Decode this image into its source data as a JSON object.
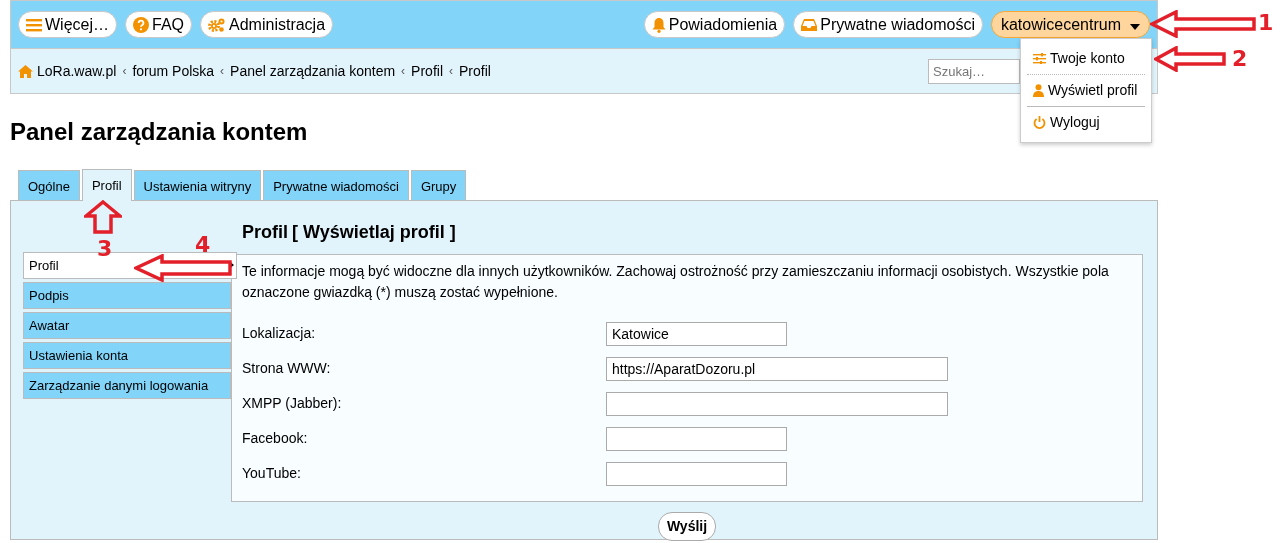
{
  "top_nav": {
    "left": [
      {
        "label": "Więcej…"
      },
      {
        "label": "FAQ"
      },
      {
        "label": "Administracja"
      }
    ],
    "right": [
      {
        "label": "Powiadomienia"
      },
      {
        "label": "Prywatne wiadomości"
      }
    ],
    "user": {
      "label": "katowicecentrum",
      "expanded": true
    }
  },
  "breadcrumbs": [
    {
      "label": "LoRa.waw.pl"
    },
    {
      "separator": "‹",
      "label": "forum Polska"
    },
    {
      "separator": "‹",
      "label": "Panel zarządzania kontem"
    },
    {
      "separator": "‹",
      "label": "Profil"
    },
    {
      "separator": "‹",
      "label": "Profil"
    }
  ],
  "search": {
    "placeholder": "Szukaj…"
  },
  "user_menu": [
    {
      "label": "Twoje konto"
    },
    {
      "label": "Wyświetl profil"
    },
    {
      "label": "Wyloguj"
    }
  ],
  "page_title": "Panel zarządzania kontem",
  "tabs": [
    {
      "label": "Ogólne",
      "selected": false
    },
    {
      "label": "Profil",
      "selected": true
    },
    {
      "label": "Ustawienia witryny",
      "selected": false
    },
    {
      "label": "Prywatne wiadomości",
      "selected": false
    },
    {
      "label": "Grupy",
      "selected": false
    }
  ],
  "sidebar": [
    {
      "label": "Profil",
      "selected": true
    },
    {
      "label": "Podpis",
      "selected": false
    },
    {
      "label": "Awatar",
      "selected": false
    },
    {
      "label": "Ustawienia konta",
      "selected": false
    },
    {
      "label": "Zarządzanie danymi logowania",
      "selected": false
    }
  ],
  "section": {
    "title": "Profil",
    "open_bracket": "[",
    "link": "Wyświetlaj profil",
    "close_bracket": "]"
  },
  "notice": "Te informacje mogą być widoczne dla innych użytkowników. Zachowaj ostrożność przy zamieszczaniu informacji osobistych. Wszystkie pola oznaczone gwiazdką (*) muszą zostać wypełnione.",
  "fields": [
    {
      "label": "Lokalizacja:",
      "value": "Katowice",
      "kind": "short"
    },
    {
      "label": "Strona WWW:",
      "value": "https://AparatDozoru.pl",
      "kind": "long"
    },
    {
      "label": "XMPP (Jabber):",
      "kind": "long"
    },
    {
      "label": "Facebook:",
      "kind": "short"
    },
    {
      "label": "YouTube:",
      "kind": "short"
    }
  ],
  "submit": "Wyślij",
  "annotations": [
    {
      "label": "1"
    },
    {
      "label": "2"
    },
    {
      "label": "3"
    },
    {
      "label": "4"
    }
  ]
}
